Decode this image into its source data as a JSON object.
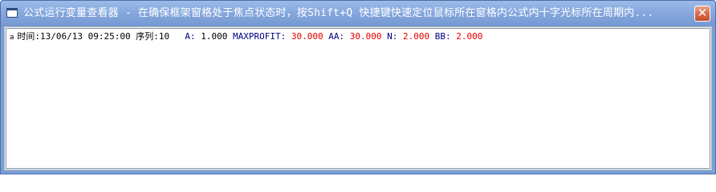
{
  "window": {
    "title": "公式运行变量查看器 - 在确保框架窗格处于焦点状态时，按Shift+Q 快捷键快速定位鼠标所在窗格内公式内十字光标所在周期内...",
    "close_label": "✕"
  },
  "row": {
    "marker": "a",
    "time_label": "时间:",
    "time_value": "13/06/13 09:25:00",
    "seq_label": "序列:",
    "seq_value": "10",
    "vars": [
      {
        "name": "A:",
        "value": "1.000",
        "color": "#000000"
      },
      {
        "name": "MAXPROFIT:",
        "value": "30.000",
        "color": "#e00000"
      },
      {
        "name": "AA:",
        "value": "30.000",
        "color": "#e00000"
      },
      {
        "name": "N:",
        "value": "2.000",
        "color": "#e00000"
      },
      {
        "name": "BB:",
        "value": "2.000",
        "color": "#e00000"
      }
    ]
  },
  "colors": {
    "title_bar": "#86a8de",
    "label_blue": "#00008b",
    "value_red": "#e00000"
  }
}
